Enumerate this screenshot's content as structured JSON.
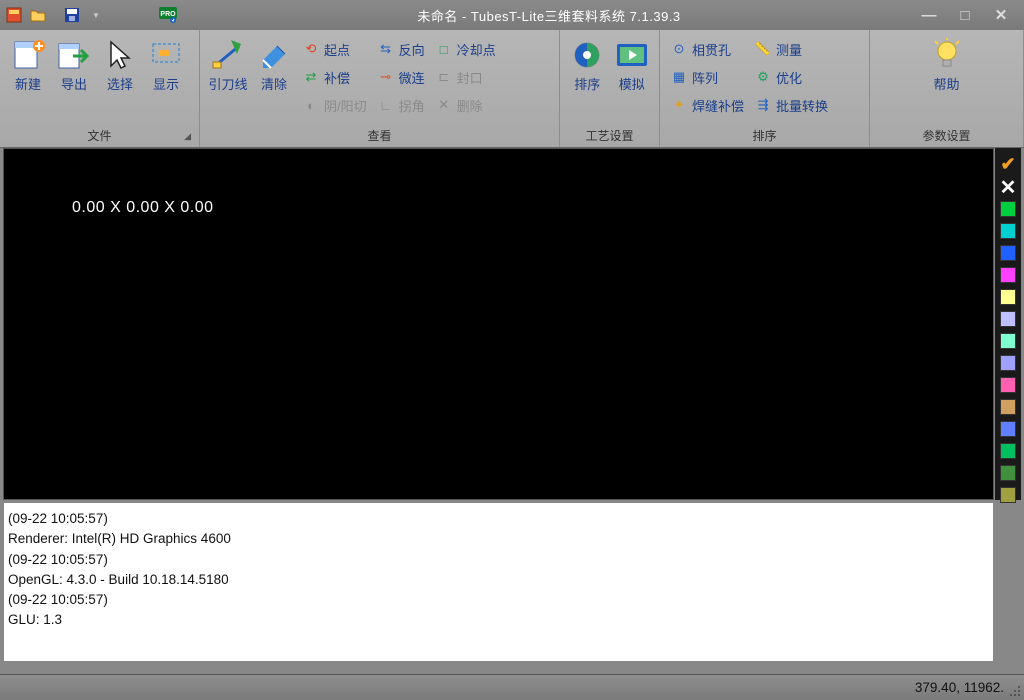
{
  "title": "未命名 - TubesT-Lite三维套料系统 7.1.39.3",
  "ribbon": {
    "file": {
      "label": "文件",
      "new": "新建",
      "export": "导出",
      "select": "选择",
      "display": "显示"
    },
    "guide": {
      "label": "查看",
      "leadline": "引刀线",
      "clear": "清除",
      "start": "起点",
      "reverse": "反向",
      "coldpoint": "冷却点",
      "compensate": "补偿",
      "microjoint": "微连",
      "seal": "封口",
      "yinyang": "阴/阳切",
      "corner": "拐角",
      "delete": "删除"
    },
    "process": {
      "label": "工艺设置",
      "sort": "排序",
      "simulate": "模拟"
    },
    "sort": {
      "label": "排序",
      "pierce": "相贯孔",
      "measure": "测量",
      "array": "阵列",
      "optimize": "优化",
      "weldcomp": "焊缝补偿",
      "batchconv": "批量转换"
    },
    "params": {
      "label": "参数设置",
      "help": "帮助"
    }
  },
  "viewport": {
    "coords": "0.00 X 0.00 X 0.00"
  },
  "colors": [
    "#00d040",
    "#00d0d0",
    "#2060ff",
    "#ff40ff",
    "#ffff90",
    "#c0c0ff",
    "#80ffd0",
    "#a0a0ff",
    "#ff60b0",
    "#d0a060",
    "#6080ff",
    "#00c060",
    "#409040",
    "#a0a040"
  ],
  "log": [
    "(09-22 10:05:57)",
    "Renderer: Intel(R) HD Graphics 4600",
    "(09-22 10:05:57)",
    "OpenGL: 4.3.0 - Build 10.18.14.5180",
    "(09-22 10:05:57)",
    "GLU: 1.3"
  ],
  "status": {
    "coords": "379.40, 11962."
  }
}
